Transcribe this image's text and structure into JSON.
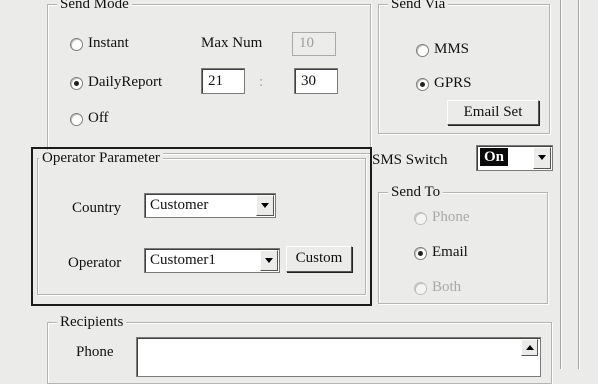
{
  "send_mode": {
    "legend": "Send Mode",
    "options": [
      {
        "label": "Instant",
        "selected": false
      },
      {
        "label": "DailyReport",
        "selected": true
      },
      {
        "label": "Off",
        "selected": false
      }
    ],
    "max_num_label": "Max Num",
    "max_num_value": "10",
    "hour_value": "21",
    "time_separator": ":",
    "minute_value": "30"
  },
  "send_via": {
    "legend": "Send Via",
    "options": [
      {
        "label": "MMS",
        "selected": false
      },
      {
        "label": "GPRS",
        "selected": true
      }
    ],
    "email_set_label": "Email Set"
  },
  "operator_parameter": {
    "legend": "Operator Parameter",
    "country_label": "Country",
    "country_value": "Customer",
    "operator_label": "Operator",
    "operator_value": "Customer1",
    "custom_button_label": "Custom"
  },
  "sms_switch": {
    "label": "SMS Switch",
    "value": "On"
  },
  "send_to": {
    "legend": "Send To",
    "options": [
      {
        "label": "Phone",
        "selected": false,
        "enabled": false
      },
      {
        "label": "Email",
        "selected": true,
        "enabled": true
      },
      {
        "label": "Both",
        "selected": false,
        "enabled": false
      }
    ]
  },
  "recipients": {
    "legend": "Recipients",
    "phone_label": "Phone",
    "phone_value": ""
  }
}
